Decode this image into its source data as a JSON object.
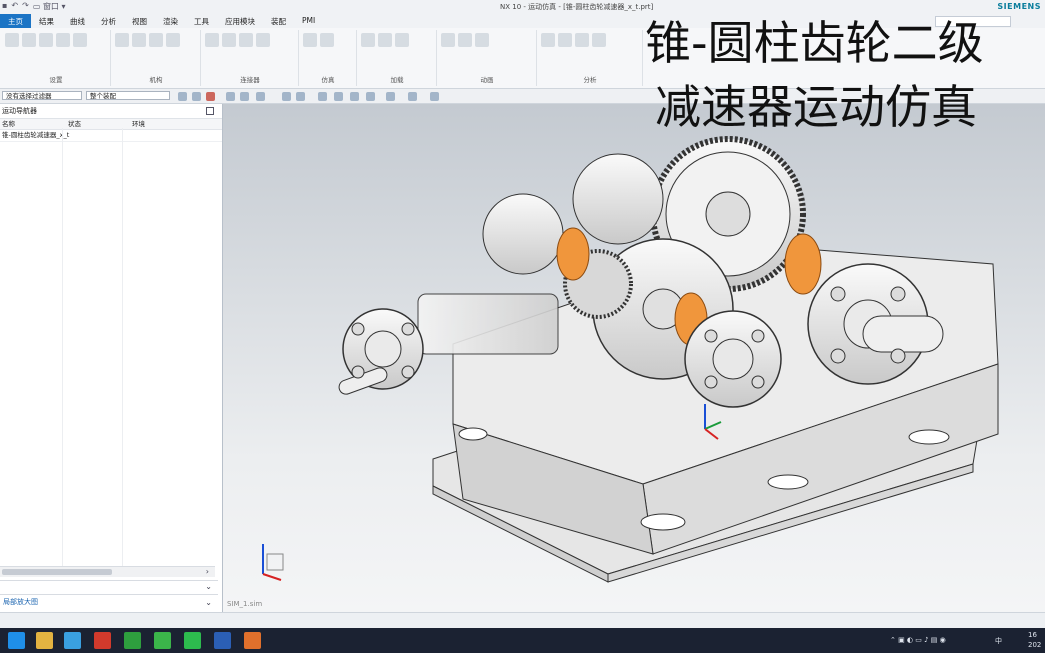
{
  "window": {
    "title": "NX 10 - 运动仿真 - [锥-圆柱齿轮减速器_x_t.prt]",
    "brand": "SIEMENS",
    "quick_access_window": "窗口"
  },
  "ribbon": {
    "tabs": [
      "主页",
      "结果",
      "曲线",
      "分析",
      "视图",
      "渲染",
      "工具",
      "应用模块",
      "装配",
      "PMI"
    ],
    "active_tab": "主页",
    "groups": [
      "设置",
      "机构",
      "连接器",
      "仿真",
      "加载",
      "动画",
      "分析"
    ]
  },
  "selection_bar": {
    "filter": "没有选择过滤器",
    "scope": "整个装配"
  },
  "navigator": {
    "header": "运动导航器",
    "columns": [
      "名称",
      "状态",
      "环境"
    ],
    "rows": [
      "锥-圆柱齿轮减速器_x_t"
    ],
    "bottom_panel": "局部放大图"
  },
  "overlay": {
    "line1": "锥-圆柱齿轮二级",
    "line2": "减速器运动仿真"
  },
  "status": {
    "sheet_label": "SIM_1.sim"
  },
  "taskbar": {
    "apps": [
      {
        "name": "edge",
        "color": "#1f8fe8"
      },
      {
        "name": "explorer",
        "color": "#e3b341"
      },
      {
        "name": "nx",
        "color": "#3aa0e0"
      },
      {
        "name": "acrobat",
        "color": "#d23a2c"
      },
      {
        "name": "green-app",
        "color": "#2e9f3e"
      },
      {
        "name": "green-c",
        "color": "#3bb54a"
      },
      {
        "name": "wechat",
        "color": "#2dbb4e"
      },
      {
        "name": "word",
        "color": "#2b5fb5"
      },
      {
        "name": "orange-app",
        "color": "#e0702c"
      }
    ],
    "tray_lang": "中",
    "time": "16",
    "date": "202"
  },
  "colors": {
    "accent": "#1b74c5",
    "bearing": "#f0963c",
    "housing": "#e8e8e8"
  }
}
